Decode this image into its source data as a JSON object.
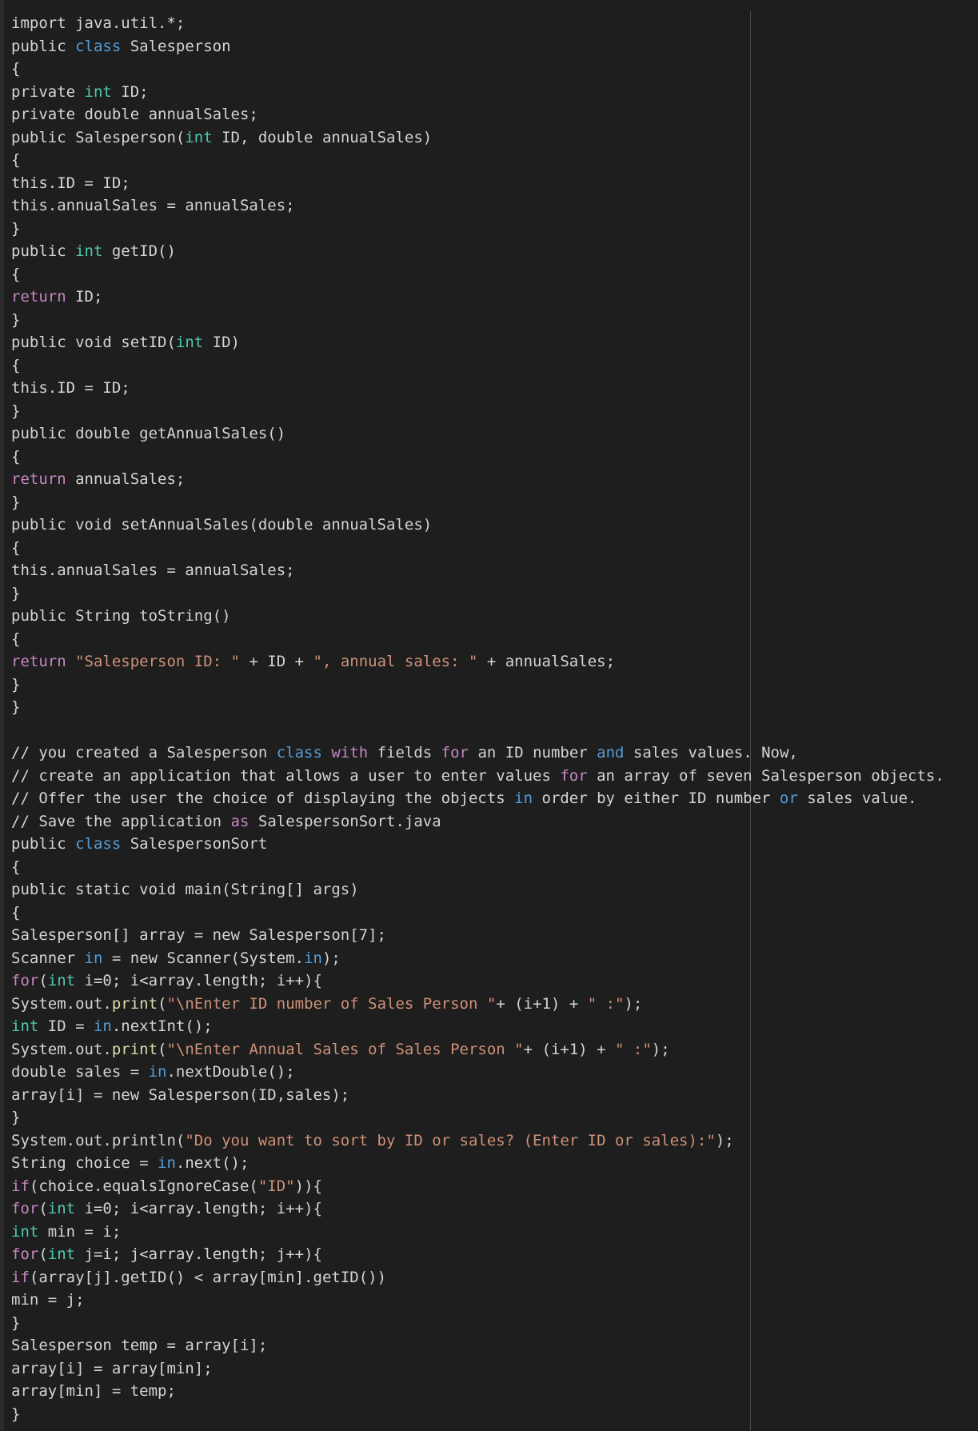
{
  "editor": {
    "lines": [
      [
        [
          "import java.util.*;",
          "plain"
        ]
      ],
      [
        [
          "public ",
          "plain"
        ],
        [
          "class",
          "kw"
        ],
        [
          " Salesperson",
          "plain"
        ]
      ],
      [
        [
          "{",
          "plain"
        ]
      ],
      [
        [
          "private ",
          "plain"
        ],
        [
          "int",
          "type"
        ],
        [
          " ID;",
          "plain"
        ]
      ],
      [
        [
          "private double annualSales;",
          "plain"
        ]
      ],
      [
        [
          "public Salesperson(",
          "plain"
        ],
        [
          "int",
          "type"
        ],
        [
          " ID, double annualSales)",
          "plain"
        ]
      ],
      [
        [
          "{",
          "plain"
        ]
      ],
      [
        [
          "this.ID = ID;",
          "plain"
        ]
      ],
      [
        [
          "this.annualSales = annualSales;",
          "plain"
        ]
      ],
      [
        [
          "}",
          "plain"
        ]
      ],
      [
        [
          "public ",
          "plain"
        ],
        [
          "int",
          "type"
        ],
        [
          " getID()",
          "plain"
        ]
      ],
      [
        [
          "{",
          "plain"
        ]
      ],
      [
        [
          "return",
          "ctl"
        ],
        [
          " ID;",
          "plain"
        ]
      ],
      [
        [
          "}",
          "plain"
        ]
      ],
      [
        [
          "public void setID(",
          "plain"
        ],
        [
          "int",
          "type"
        ],
        [
          " ID)",
          "plain"
        ]
      ],
      [
        [
          "{",
          "plain"
        ]
      ],
      [
        [
          "this.ID = ID;",
          "plain"
        ]
      ],
      [
        [
          "}",
          "plain"
        ]
      ],
      [
        [
          "public double getAnnualSales()",
          "plain"
        ]
      ],
      [
        [
          "{",
          "plain"
        ]
      ],
      [
        [
          "return",
          "ctl"
        ],
        [
          " annualSales;",
          "plain"
        ]
      ],
      [
        [
          "}",
          "plain"
        ]
      ],
      [
        [
          "public void setAnnualSales(double annualSales)",
          "plain"
        ]
      ],
      [
        [
          "{",
          "plain"
        ]
      ],
      [
        [
          "this.annualSales = annualSales;",
          "plain"
        ]
      ],
      [
        [
          "}",
          "plain"
        ]
      ],
      [
        [
          "public String toString()",
          "plain"
        ]
      ],
      [
        [
          "{",
          "plain"
        ]
      ],
      [
        [
          "return",
          "ctl"
        ],
        [
          " ",
          "plain"
        ],
        [
          "\"Salesperson ID: \"",
          "str"
        ],
        [
          " + ID + ",
          "plain"
        ],
        [
          "\", annual sales: \"",
          "str"
        ],
        [
          " + annualSales;",
          "plain"
        ]
      ],
      [
        [
          "}",
          "plain"
        ]
      ],
      [
        [
          "}",
          "plain"
        ]
      ],
      [
        [
          "",
          "plain"
        ]
      ],
      [
        [
          "// you created a Salesperson ",
          "cmt"
        ],
        [
          "class",
          "kw"
        ],
        [
          " ",
          "cmt"
        ],
        [
          "with",
          "ctl"
        ],
        [
          " fields ",
          "cmt"
        ],
        [
          "for",
          "ctl"
        ],
        [
          " an ID number ",
          "cmt"
        ],
        [
          "and",
          "kw"
        ],
        [
          " sales values. Now,",
          "cmt"
        ]
      ],
      [
        [
          "// create an application that allows a user to enter values ",
          "cmt"
        ],
        [
          "for",
          "ctl"
        ],
        [
          " an array of seven Salesperson objects.",
          "cmt"
        ]
      ],
      [
        [
          "// Offer the user the choice of displaying the objects ",
          "cmt"
        ],
        [
          "in",
          "kw"
        ],
        [
          " order by either ID number ",
          "cmt"
        ],
        [
          "or",
          "kw"
        ],
        [
          " sales value.",
          "cmt"
        ]
      ],
      [
        [
          "// Save the application ",
          "cmt"
        ],
        [
          "as",
          "ctl"
        ],
        [
          " SalespersonSort.java",
          "cmt"
        ]
      ],
      [
        [
          "public ",
          "plain"
        ],
        [
          "class",
          "kw"
        ],
        [
          " SalespersonSort",
          "plain"
        ]
      ],
      [
        [
          "{",
          "plain"
        ]
      ],
      [
        [
          "public static void main(String[] args)",
          "plain"
        ]
      ],
      [
        [
          "{",
          "plain"
        ]
      ],
      [
        [
          "Salesperson[] array = new Salesperson[7];",
          "plain"
        ]
      ],
      [
        [
          "Scanner ",
          "plain"
        ],
        [
          "in",
          "kw"
        ],
        [
          " = new Scanner(System.",
          "plain"
        ],
        [
          "in",
          "kw"
        ],
        [
          ");",
          "plain"
        ]
      ],
      [
        [
          "for",
          "ctl"
        ],
        [
          "(",
          "plain"
        ],
        [
          "int",
          "type"
        ],
        [
          " i=0; i<array.length; i++){",
          "plain"
        ]
      ],
      [
        [
          "System.out.",
          "plain"
        ],
        [
          "print",
          "fn"
        ],
        [
          "(",
          "plain"
        ],
        [
          "\"\\nEnter ID number of Sales Person \"",
          "str"
        ],
        [
          "+ (i+1) + ",
          "plain"
        ],
        [
          "\" :\"",
          "str"
        ],
        [
          ");",
          "plain"
        ]
      ],
      [
        [
          "int",
          "type"
        ],
        [
          " ID = ",
          "plain"
        ],
        [
          "in",
          "kw"
        ],
        [
          ".nextInt();",
          "plain"
        ]
      ],
      [
        [
          "System.out.",
          "plain"
        ],
        [
          "print",
          "fn"
        ],
        [
          "(",
          "plain"
        ],
        [
          "\"\\nEnter Annual Sales of Sales Person \"",
          "str"
        ],
        [
          "+ (i+1) + ",
          "plain"
        ],
        [
          "\" :\"",
          "str"
        ],
        [
          ");",
          "plain"
        ]
      ],
      [
        [
          "double sales = ",
          "plain"
        ],
        [
          "in",
          "kw"
        ],
        [
          ".nextDouble();",
          "plain"
        ]
      ],
      [
        [
          "array[i] = new Salesperson(ID,sales);",
          "plain"
        ]
      ],
      [
        [
          "}",
          "plain"
        ]
      ],
      [
        [
          "System.out.println(",
          "plain"
        ],
        [
          "\"Do you want to sort by ID or sales? (Enter ID or sales):\"",
          "str"
        ],
        [
          ");",
          "plain"
        ]
      ],
      [
        [
          "String choice = ",
          "plain"
        ],
        [
          "in",
          "kw"
        ],
        [
          ".next();",
          "plain"
        ]
      ],
      [
        [
          "if",
          "ctl"
        ],
        [
          "(choice.equalsIgnoreCase(",
          "plain"
        ],
        [
          "\"ID\"",
          "str"
        ],
        [
          ")){",
          "plain"
        ]
      ],
      [
        [
          "for",
          "ctl"
        ],
        [
          "(",
          "plain"
        ],
        [
          "int",
          "type"
        ],
        [
          " i=0; i<array.length; i++){",
          "plain"
        ]
      ],
      [
        [
          "int",
          "type"
        ],
        [
          " min = i;",
          "plain"
        ]
      ],
      [
        [
          "for",
          "ctl"
        ],
        [
          "(",
          "plain"
        ],
        [
          "int",
          "type"
        ],
        [
          " j=i; j<array.length; j++){",
          "plain"
        ]
      ],
      [
        [
          "if",
          "ctl"
        ],
        [
          "(array[j].getID() < array[min].getID())",
          "plain"
        ]
      ],
      [
        [
          "min = j;",
          "plain"
        ]
      ],
      [
        [
          "}",
          "plain"
        ]
      ],
      [
        [
          "Salesperson temp = array[i];",
          "plain"
        ]
      ],
      [
        [
          "array[i] = array[min];",
          "plain"
        ]
      ],
      [
        [
          "array[min] = temp;",
          "plain"
        ]
      ],
      [
        [
          "}",
          "plain"
        ]
      ]
    ]
  }
}
